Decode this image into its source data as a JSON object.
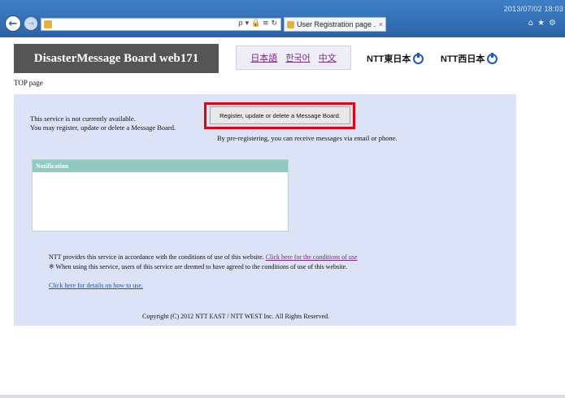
{
  "browser": {
    "timestamp": "2013/07/02 18:03",
    "address_tools": "ρ ▾ 🔒 ≡ ↻",
    "tab_label": "User Registration page ...",
    "tab_close": "×",
    "back_glyph": "←",
    "forward_glyph": "→",
    "right_icons": "⌂★⚙",
    "icons": [
      "back-arrow-icon",
      "forward-arrow-icon",
      "page-icon",
      "search-icon",
      "lock-icon",
      "refresh-icon",
      "close-icon",
      "home-icon",
      "star-icon",
      "gear-icon"
    ]
  },
  "header": {
    "logo_text": "DisasterMessage Board web171",
    "languages": [
      "日本語",
      "한국어",
      "中文"
    ],
    "ntt_east": "NTT東日本",
    "ntt_west": "NTT西日本"
  },
  "breadcrumb": "TOP page",
  "main": {
    "status_line_1": "This service is not currently available.",
    "status_line_2": "You may register, update or delete a Message Board.",
    "register_button": "Register, update or delete a Message Board.",
    "prereg_text": "By pre-registering, you can receive messages via email or phone.",
    "notification_header": "Notification",
    "terms_text": "NTT provides this service in accordance with the conditions of use of this website.",
    "terms_link": "Click here for the conditions of use",
    "terms_note": "※ When using this service, users of this service are deemed to have agreed to the conditions of use of this website.",
    "howto_link": "Click here for details on how to use.",
    "copyright": "Copyright (C) 2012 NTT EAST / NTT WEST Inc. All Rights Reserved."
  },
  "colors": {
    "chrome_blue": "#2b63a8",
    "panel_bg": "#dce3f7",
    "highlight_red": "#e00010",
    "notification_teal": "#8fc9c2",
    "link_purple": "#7a2a86",
    "link_blue": "#1f4fb0"
  }
}
